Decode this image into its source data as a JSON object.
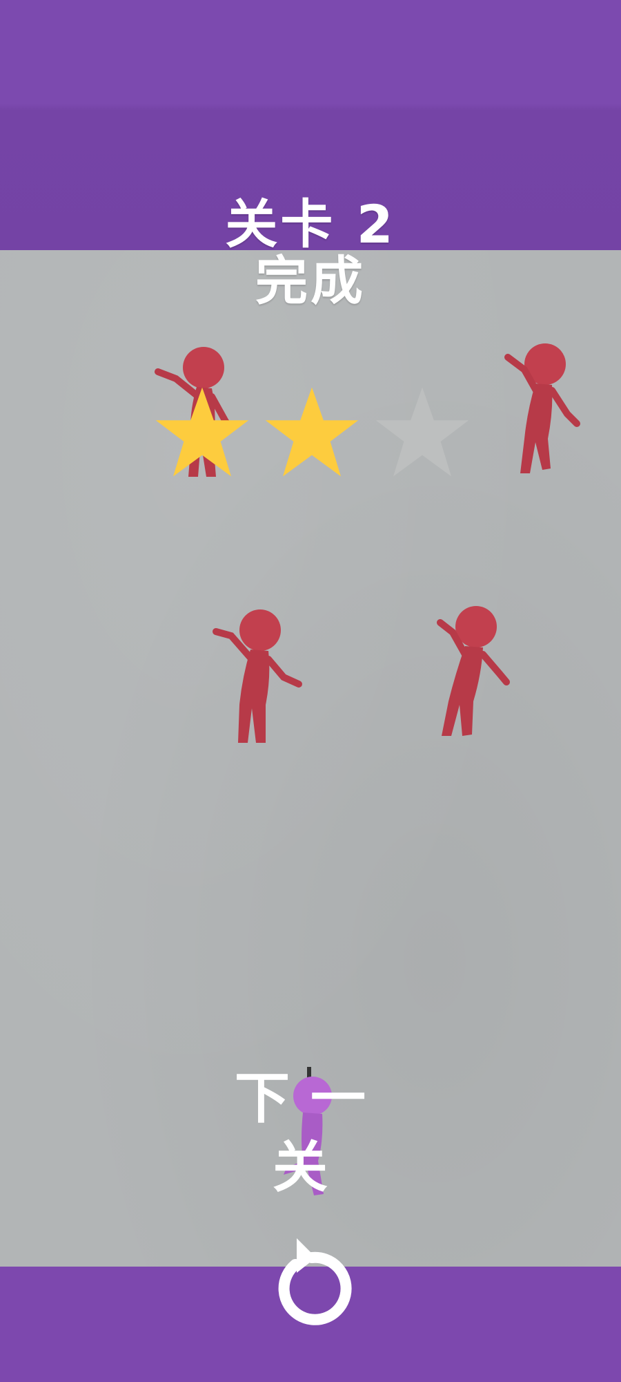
{
  "level": {
    "title": "关卡 2",
    "status": "完成"
  },
  "rating": {
    "stars_earned": 2,
    "stars_total": 3
  },
  "buttons": {
    "next_label": "下一关",
    "restart_icon": "restart-icon"
  },
  "colors": {
    "bar": "#7c4aaf",
    "floor": "#b2b5b6",
    "star_filled": "#fdcc3e",
    "star_empty": "#bdbfbf",
    "enemy": "#c2404e",
    "player": "#b868d4"
  }
}
